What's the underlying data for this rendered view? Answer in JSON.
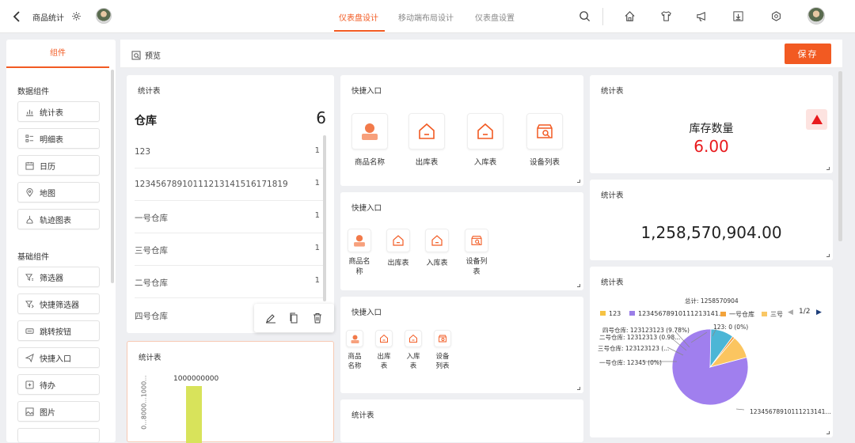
{
  "topbar": {
    "title": "商品统计",
    "tabs": [
      {
        "label": "仪表盘设计",
        "active": true
      },
      {
        "label": "移动端布局设计",
        "active": false
      },
      {
        "label": "仪表盘设置",
        "active": false
      }
    ],
    "icons": [
      "search-icon",
      "home-icon",
      "shirt-icon",
      "megaphone-icon",
      "download-icon",
      "hexagon-icon"
    ]
  },
  "sidebar": {
    "tab": "组件",
    "data_section": "数据组件",
    "data_items": [
      {
        "label": "统计表",
        "icon": "bar-chart-icon"
      },
      {
        "label": "明细表",
        "icon": "detail-list-icon"
      },
      {
        "label": "日历",
        "icon": "calendar-icon"
      },
      {
        "label": "地图",
        "icon": "map-pin-icon"
      },
      {
        "label": "轨迹图表",
        "icon": "track-icon"
      }
    ],
    "basic_section": "基础组件",
    "basic_items": [
      {
        "label": "筛选器",
        "icon": "filter-icon"
      },
      {
        "label": "快捷筛选器",
        "icon": "quick-filter-icon"
      },
      {
        "label": "跳转按钮",
        "icon": "jump-button-icon"
      },
      {
        "label": "快捷入口",
        "icon": "paper-plane-icon"
      },
      {
        "label": "待办",
        "icon": "todo-icon"
      },
      {
        "label": "图片",
        "icon": "image-icon"
      }
    ]
  },
  "toolbar": {
    "preview_label": "预览",
    "save_label": "保存"
  },
  "card_list": {
    "title": "统计表",
    "header_name": "仓库",
    "header_value": "6",
    "rows": [
      {
        "name": "123",
        "value": "1"
      },
      {
        "name": "12345678910111213141516171819",
        "value": "1"
      },
      {
        "name": "一号仓库",
        "value": "1"
      },
      {
        "name": "三号仓库",
        "value": "1"
      },
      {
        "name": "二号仓库",
        "value": "1"
      },
      {
        "name": "四号仓库",
        "value": ""
      }
    ]
  },
  "card_bar": {
    "title": "统计表",
    "bar_label": "1000000000",
    "y_ticks": "0...8000...1000..."
  },
  "quick1": {
    "title": "快捷入口",
    "items": [
      "商品名称",
      "出库表",
      "入库表",
      "设备列表"
    ]
  },
  "quick2": {
    "title": "快捷入口",
    "items": [
      "商品名\n称",
      "出库表",
      "入库表",
      "设备列\n表"
    ]
  },
  "quick3": {
    "title": "快捷入口",
    "items": [
      "商品\n名称",
      "出库\n表",
      "入库\n表",
      "设备\n列表"
    ]
  },
  "card_bottom_mid": {
    "title": "统计表"
  },
  "card_stock": {
    "title": "统计表",
    "label": "库存数量",
    "value": "6.00"
  },
  "card_big": {
    "title": "统计表",
    "value": "1,258,570,904.00"
  },
  "card_pie": {
    "title": "统计表",
    "total": "总计: 1258570904",
    "legend": [
      {
        "label": "123",
        "color": "#f6c344"
      },
      {
        "label": "12345678910111213141...",
        "color": "#9b7fe8"
      },
      {
        "label": "一号仓库",
        "color": "#f3a33a"
      },
      {
        "label": "三号",
        "color": "#f9c765"
      }
    ],
    "pager": "1/2",
    "labels": [
      "四号仓库: 123123123 (9.78%)",
      "二号仓库: 12312313 (0.98...",
      "三号仓库: 123123123 (...",
      "一号仓库: 12345 (0%)",
      "123: 0 (0%)",
      "12345678910111213141..."
    ]
  },
  "chart_data": {
    "type": "pie",
    "title": "",
    "total": 1258570904,
    "slices": [
      {
        "name": "12345678910111213141...",
        "percent": 80.4,
        "color": "#a07fee"
      },
      {
        "name": "四号仓库",
        "value": 123123123,
        "percent": 9.78,
        "color": "#4cb6d6"
      },
      {
        "name": "二号仓库",
        "value": 12312313,
        "percent": 0.98,
        "color": "#f39a3a"
      },
      {
        "name": "三号仓库",
        "value": 123123123,
        "percent": 9.78,
        "color": "#fbc560"
      },
      {
        "name": "一号仓库",
        "value": 12345,
        "percent": 0,
        "color": "#f3a33a"
      },
      {
        "name": "123",
        "value": 0,
        "percent": 0,
        "color": "#f6c344"
      }
    ]
  }
}
